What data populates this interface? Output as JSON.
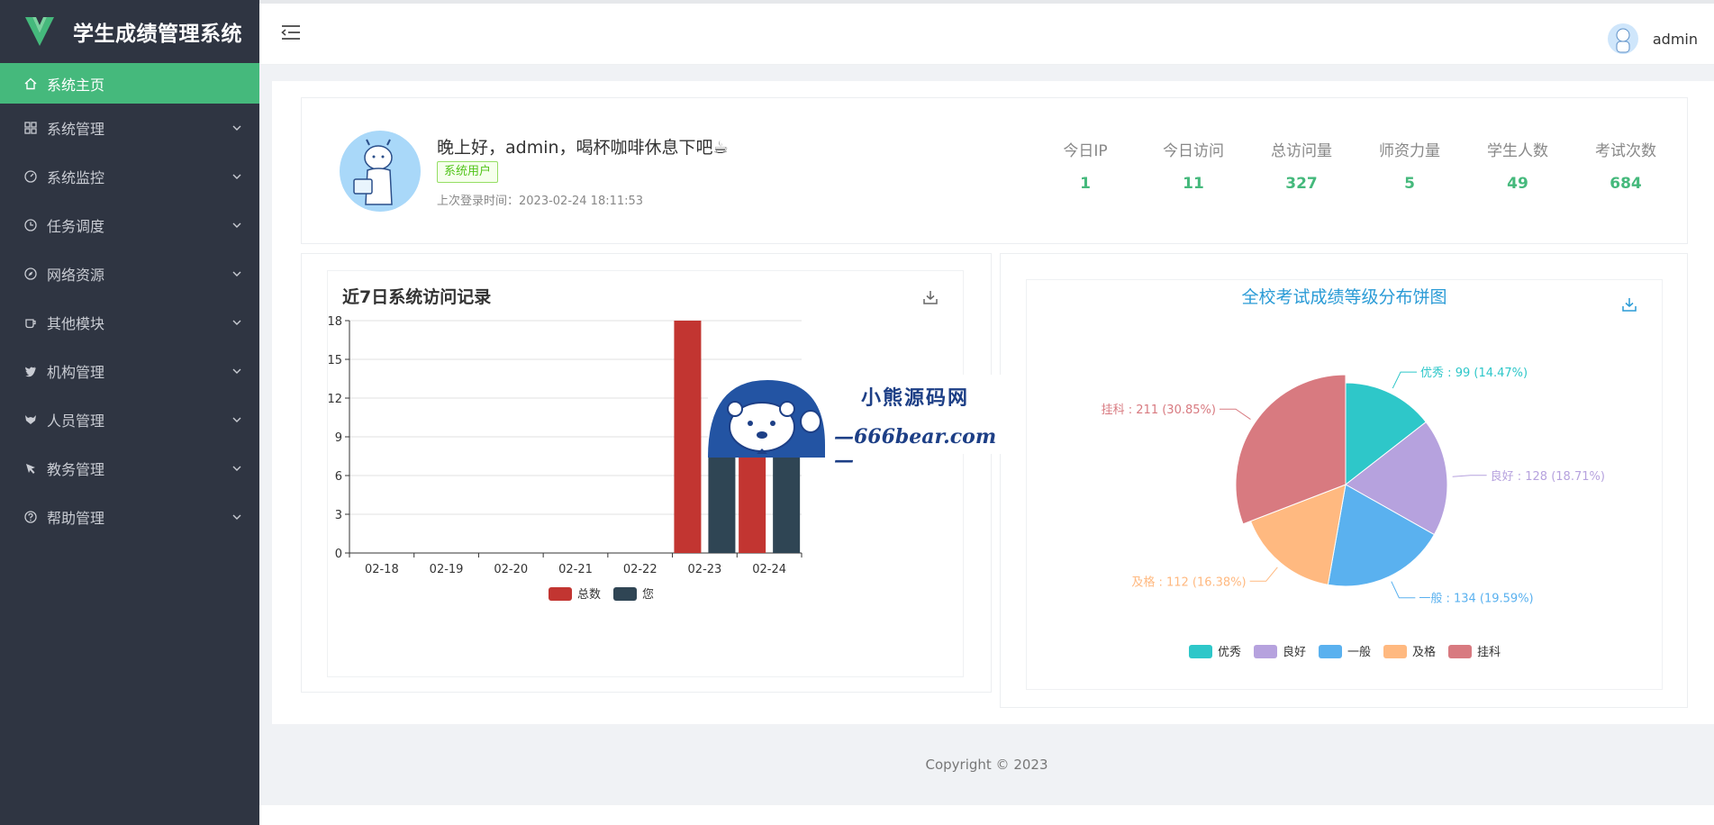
{
  "app": {
    "title": "学生成绩管理系统"
  },
  "sidebar": {
    "items": [
      {
        "label": "系统主页",
        "icon": "home-icon",
        "active": true
      },
      {
        "label": "系统管理",
        "icon": "grid-icon"
      },
      {
        "label": "系统监控",
        "icon": "dashboard-icon"
      },
      {
        "label": "任务调度",
        "icon": "clock-icon"
      },
      {
        "label": "网络资源",
        "icon": "compass-icon"
      },
      {
        "label": "其他模块",
        "icon": "coffee-icon"
      },
      {
        "label": "机构管理",
        "icon": "twitter-icon"
      },
      {
        "label": "人员管理",
        "icon": "fox-icon"
      },
      {
        "label": "教务管理",
        "icon": "pointer-icon"
      },
      {
        "label": "帮助管理",
        "icon": "question-icon"
      }
    ]
  },
  "header": {
    "username": "admin"
  },
  "welcome": {
    "greeting": "晚上好，admin，喝杯咖啡休息下吧☕",
    "role": "系统用户",
    "last_login": "上次登录时间：2023-02-24 18:11:53"
  },
  "stats": [
    {
      "label": "今日IP",
      "value": "1"
    },
    {
      "label": "今日访问",
      "value": "11"
    },
    {
      "label": "总访问量",
      "value": "327"
    },
    {
      "label": "师资力量",
      "value": "5"
    },
    {
      "label": "学生人数",
      "value": "49"
    },
    {
      "label": "考试次数",
      "value": "684"
    }
  ],
  "watermark": {
    "line1": "小熊源码网",
    "line2": "—666bear.com—"
  },
  "footer": {
    "copyright": "Copyright © 2023"
  },
  "colors": {
    "accent": "#45b97c",
    "sidebar": "#2f3542",
    "total": "#c23531",
    "you": "#2f4554",
    "excellent": "#2ec7c9",
    "good": "#b6a2de",
    "normal": "#5ab1ef",
    "pass": "#ffb980",
    "fail": "#d87a80"
  },
  "chart_data": [
    {
      "type": "bar",
      "title": "近7日系统访问记录",
      "categories": [
        "02-18",
        "02-19",
        "02-20",
        "02-21",
        "02-22",
        "02-23",
        "02-24"
      ],
      "series": [
        {
          "name": "总数",
          "values": [
            0,
            0,
            0,
            0,
            0,
            18,
            11
          ]
        },
        {
          "name": "您",
          "values": [
            0,
            0,
            0,
            0,
            0,
            10,
            8
          ]
        }
      ],
      "yticks": [
        0,
        3,
        6,
        9,
        12,
        15,
        18
      ],
      "ylim": [
        0,
        18
      ],
      "grid": true,
      "legend": "bottom-center"
    },
    {
      "type": "pie",
      "title": "全校考试成绩等级分布饼图",
      "slices": [
        {
          "name": "优秀",
          "value": 99,
          "label": "优秀 : 99 (14.47%)"
        },
        {
          "name": "良好",
          "value": 128,
          "label": "良好 : 128 (18.71%)"
        },
        {
          "name": "一般",
          "value": 134,
          "label": "一般 : 134 (19.59%)"
        },
        {
          "name": "及格",
          "value": 112,
          "label": "及格 : 112 (16.38%)"
        },
        {
          "name": "挂科",
          "value": 211,
          "label": "挂科 : 211 (30.85%)"
        }
      ],
      "legend": "bottom-center"
    }
  ]
}
